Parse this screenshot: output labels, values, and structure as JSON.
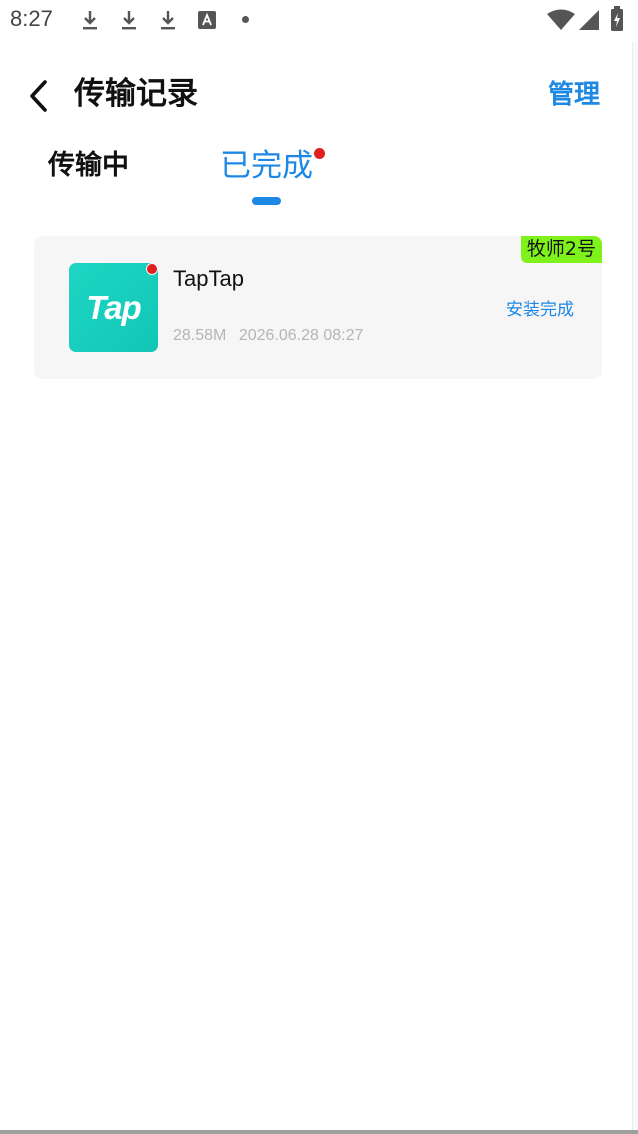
{
  "status_bar": {
    "time": "8:27",
    "icons": [
      "download-icon",
      "download-icon",
      "download-icon",
      "a-notification-icon",
      "dot-icon",
      "wifi-icon",
      "signal-icon",
      "battery-icon"
    ]
  },
  "header": {
    "title": "传输记录",
    "back_icon": "chevron-left-icon",
    "manage_label": "管理"
  },
  "tabs": [
    {
      "label": "传输中",
      "active": false
    },
    {
      "label": "已完成",
      "active": true,
      "has_badge": true
    }
  ],
  "records": [
    {
      "device_tag": "牧师2号",
      "app_icon_text": "Tap",
      "app_name": "TapTap",
      "size": "28.58M",
      "datetime": "2026.06.28 08:27",
      "status": "安装完成"
    }
  ],
  "colors": {
    "accent": "#1e88e5",
    "badge_red": "#e02020",
    "tag_green": "#7ef21a",
    "icon_teal": "#1ed6c3",
    "card_bg": "#f6f6f6"
  }
}
